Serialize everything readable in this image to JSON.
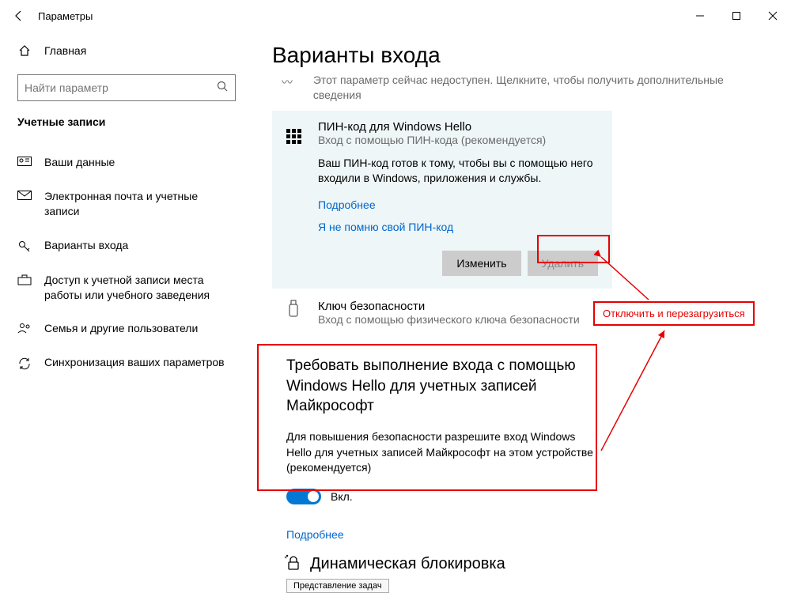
{
  "window": {
    "title": "Параметры"
  },
  "sidebar": {
    "home": "Главная",
    "search_placeholder": "Найти параметр",
    "section": "Учетные записи",
    "items": [
      "Ваши данные",
      "Электронная почта и учетные записи",
      "Варианты входа",
      "Доступ к учетной записи места работы или учебного заведения",
      "Семья и другие пользователи",
      "Синхронизация ваших параметров"
    ]
  },
  "page": {
    "title": "Варианты входа",
    "unavailable": "Этот параметр сейчас недоступен. Щелкните, чтобы получить дополнительные сведения",
    "pin": {
      "title": "ПИН-код для Windows Hello",
      "subtitle": "Вход с помощью ПИН-кода (рекомендуется)",
      "body": "Ваш ПИН-код готов к тому, чтобы вы с помощью него входили в Windows, приложения и службы.",
      "learn_more": "Подробнее",
      "forgot": "Я не помню свой ПИН-код",
      "change": "Изменить",
      "remove": "Удалить"
    },
    "security_key": {
      "title": "Ключ безопасности",
      "subtitle": "Вход с помощью физического ключа безопасности"
    },
    "require_hello": {
      "heading": "Требовать выполнение входа с помощью Windows Hello для учетных записей Майкрософт",
      "desc": "Для повышения безопасности разрешите вход Windows Hello для учетных записей Майкрософт на этом устройстве (рекомендуется)",
      "state": "Вкл."
    },
    "more": "Подробнее",
    "dynamic_lock": "Динамическая блокировка",
    "task_view": "Представление задач"
  },
  "annotation": {
    "callout": "Отключить и перезагрузиться"
  }
}
